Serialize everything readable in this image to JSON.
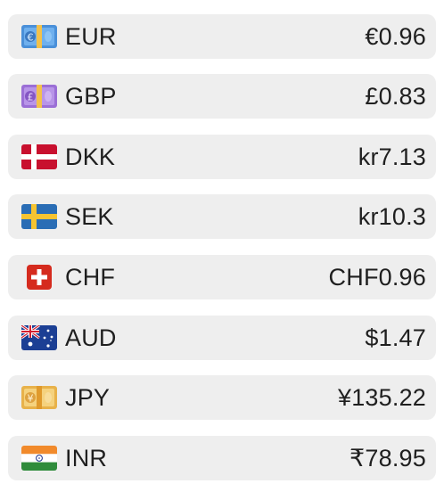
{
  "currencies": [
    {
      "code": "EUR",
      "value": "€0.96",
      "icon": "euro-banknote-icon"
    },
    {
      "code": "GBP",
      "value": "£0.83",
      "icon": "pound-banknote-icon"
    },
    {
      "code": "DKK",
      "value": "kr7.13",
      "icon": "denmark-flag-icon"
    },
    {
      "code": "SEK",
      "value": "kr10.3",
      "icon": "sweden-flag-icon"
    },
    {
      "code": "CHF",
      "value": "CHF0.96",
      "icon": "switzerland-flag-icon"
    },
    {
      "code": "AUD",
      "value": "$1.47",
      "icon": "australia-flag-icon"
    },
    {
      "code": "JPY",
      "value": "¥135.22",
      "icon": "yen-banknote-icon"
    },
    {
      "code": "INR",
      "value": "₹78.95",
      "icon": "india-flag-icon"
    }
  ],
  "colors": {
    "row_background": "#eeeeee",
    "text": "#1f1f1f"
  }
}
